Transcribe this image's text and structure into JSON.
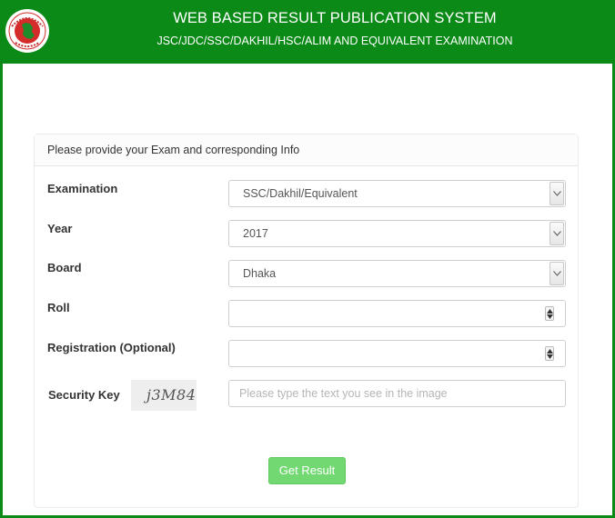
{
  "header": {
    "title": "WEB BASED RESULT PUBLICATION SYSTEM",
    "subtitle": "JSC/JDC/SSC/DAKHIL/HSC/ALIM AND EQUIVALENT EXAMINATION",
    "logo_icon": "government-seal-icon",
    "color": "#0b8a17"
  },
  "form": {
    "heading": "Please provide your Exam and corresponding Info",
    "examination": {
      "label": "Examination",
      "value": "SSC/Dakhil/Equivalent"
    },
    "year": {
      "label": "Year",
      "value": "2017"
    },
    "board": {
      "label": "Board",
      "value": "Dhaka"
    },
    "roll": {
      "label": "Roll",
      "value": ""
    },
    "registration": {
      "label": "Registration (Optional)",
      "value": ""
    },
    "security": {
      "label": "Security Key",
      "captcha_text": "j3M84",
      "placeholder": "Please type the text you see in the image",
      "value": ""
    },
    "submit_label": "Get Result",
    "submit_color": "#72d972"
  }
}
